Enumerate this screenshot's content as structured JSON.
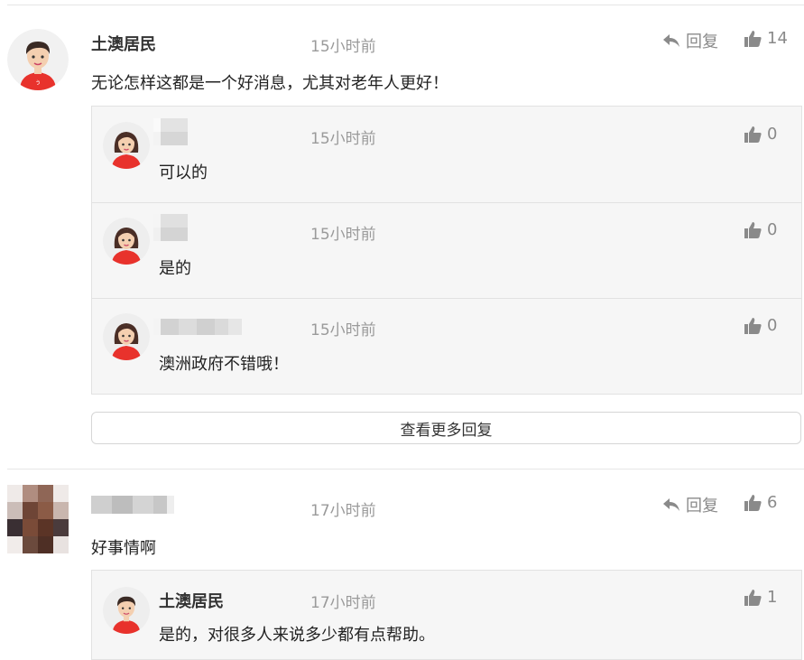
{
  "icons": {
    "reply": "reply-arrow-icon",
    "like": "thumbs-up-icon"
  },
  "colors": {
    "brand_red": "#e8322c",
    "muted": "#9a9a9a",
    "reply_bg": "#f6f6f6"
  },
  "comments": [
    {
      "author": "土澳居民",
      "time": "15小时前",
      "text": "无论怎样这都是一个好消息，尤其对老年人更好！",
      "reply_label": "回复",
      "likes": "14",
      "replies": [
        {
          "time": "15小时前",
          "text": "可以的",
          "likes": "0"
        },
        {
          "time": "15小时前",
          "text": "是的",
          "likes": "0"
        },
        {
          "time": "15小时前",
          "text": "澳洲政府不错哦！",
          "likes": "0"
        }
      ],
      "more_label": "查看更多回复"
    },
    {
      "time": "17小时前",
      "text": "好事情啊",
      "reply_label": "回复",
      "likes": "6",
      "replies": [
        {
          "author": "土澳居民",
          "time": "17小时前",
          "text": "是的，对很多人来说多少都有点帮助。",
          "likes": "1"
        }
      ]
    }
  ]
}
